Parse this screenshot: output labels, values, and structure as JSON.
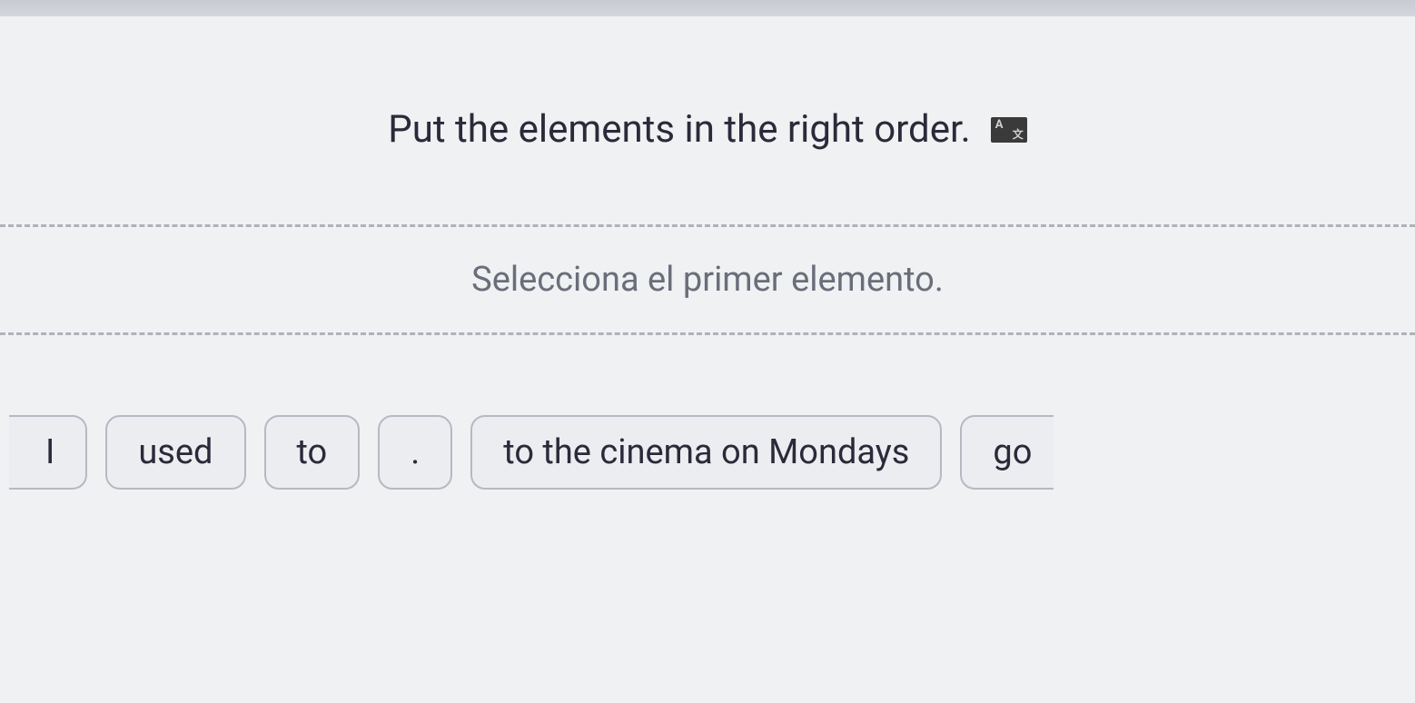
{
  "instruction": {
    "text": "Put the elements in the right order.",
    "translate_icon": "translate-icon"
  },
  "hint": {
    "text": "Selecciona el primer elemento."
  },
  "tokens": [
    {
      "label": "I"
    },
    {
      "label": "used"
    },
    {
      "label": "to"
    },
    {
      "label": "."
    },
    {
      "label": "to the cinema on Mondays"
    },
    {
      "label": "go"
    }
  ]
}
